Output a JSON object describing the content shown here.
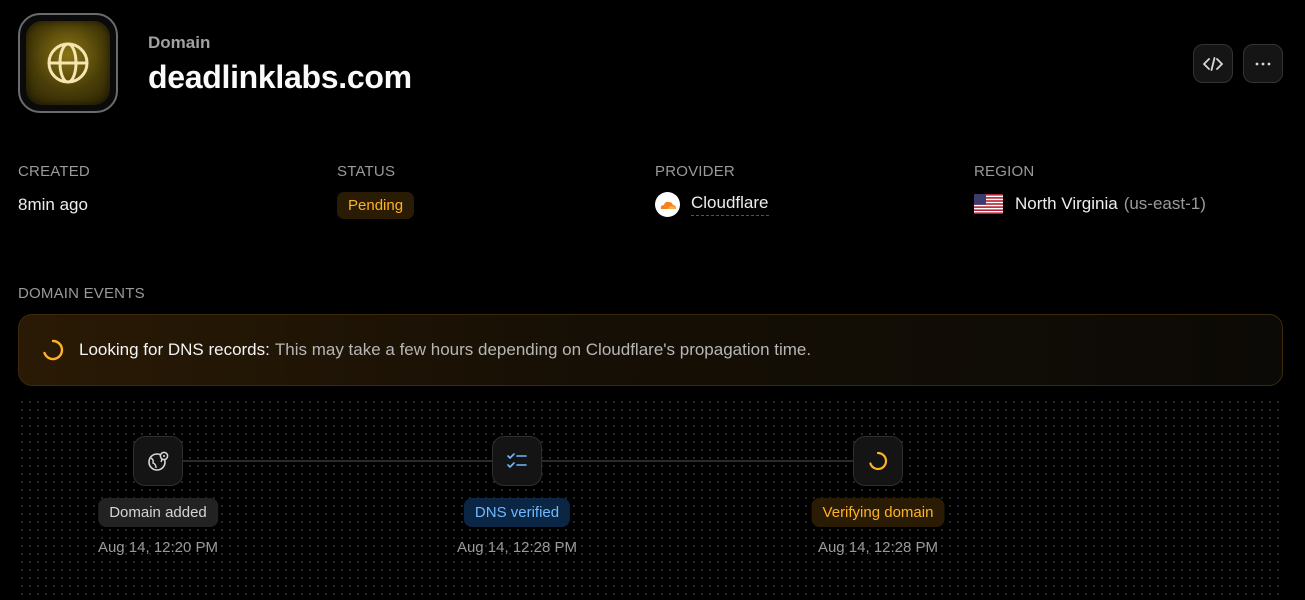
{
  "header": {
    "label": "Domain",
    "title": "deadlinklabs.com"
  },
  "stats": {
    "created": {
      "label": "CREATED",
      "value": "8min ago"
    },
    "status": {
      "label": "STATUS",
      "value": "Pending"
    },
    "provider": {
      "label": "PROVIDER",
      "value": "Cloudflare"
    },
    "region": {
      "label": "REGION",
      "value": "North Virginia",
      "code": "(us-east-1)"
    }
  },
  "events": {
    "label": "DOMAIN EVENTS",
    "banner": {
      "strong": "Looking for DNS records:",
      "text": "This may take a few hours depending on Cloudflare's propagation time."
    },
    "steps": [
      {
        "label": "Domain added",
        "time": "Aug 14, 12:20 PM",
        "icon": "globe-pin-icon"
      },
      {
        "label": "DNS verified",
        "time": "Aug 14, 12:28 PM",
        "icon": "checklist-icon"
      },
      {
        "label": "Verifying domain",
        "time": "Aug 14, 12:28 PM",
        "icon": "spinner-icon"
      }
    ]
  },
  "colors": {
    "accent_amber": "#ffb224",
    "accent_blue": "#70b8ff",
    "background": "#000000"
  }
}
